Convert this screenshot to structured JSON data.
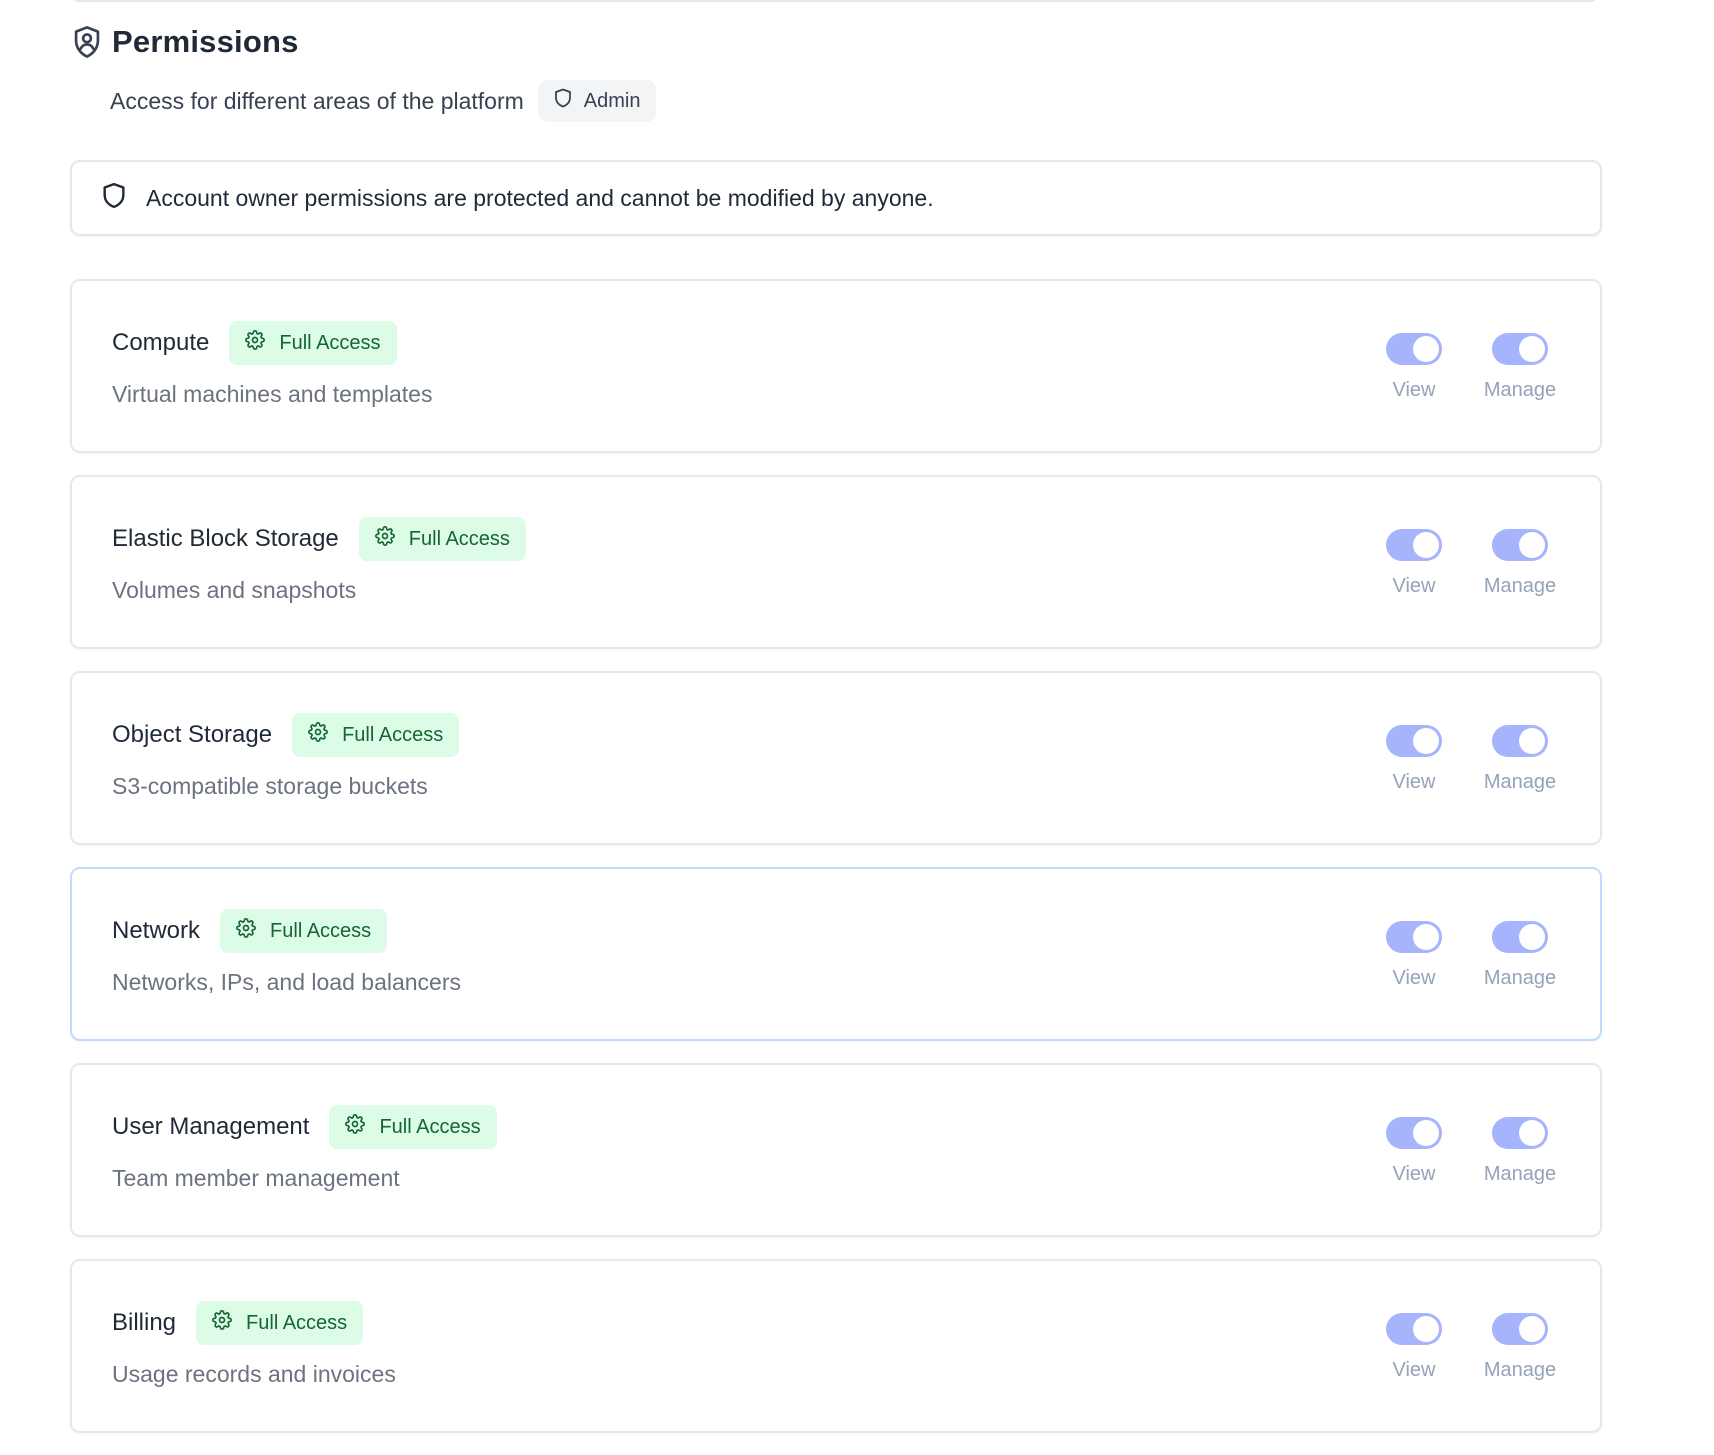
{
  "header": {
    "title": "Permissions",
    "subtitle": "Access for different areas of the platform",
    "role_badge": "Admin"
  },
  "notice": {
    "text": "Account owner permissions are protected and cannot be modified by anyone."
  },
  "labels": {
    "view": "View",
    "manage": "Manage"
  },
  "colors": {
    "badge_bg": "#dcfce7",
    "badge_text": "#166534",
    "toggle_on": "#a5b4fc",
    "highlight_border": "#bfdbfe"
  },
  "permissions": [
    {
      "name": "Compute",
      "badge": "Full Access",
      "description": "Virtual machines and templates",
      "view": true,
      "manage": true
    },
    {
      "name": "Elastic Block Storage",
      "badge": "Full Access",
      "description": "Volumes and snapshots",
      "view": true,
      "manage": true
    },
    {
      "name": "Object Storage",
      "badge": "Full Access",
      "description": "S3-compatible storage buckets",
      "view": true,
      "manage": true
    },
    {
      "name": "Network",
      "badge": "Full Access",
      "description": "Networks, IPs, and load balancers",
      "view": true,
      "manage": true
    },
    {
      "name": "User Management",
      "badge": "Full Access",
      "description": "Team member management",
      "view": true,
      "manage": true
    },
    {
      "name": "Billing",
      "badge": "Full Access",
      "description": "Usage records and invoices",
      "view": true,
      "manage": true
    }
  ]
}
